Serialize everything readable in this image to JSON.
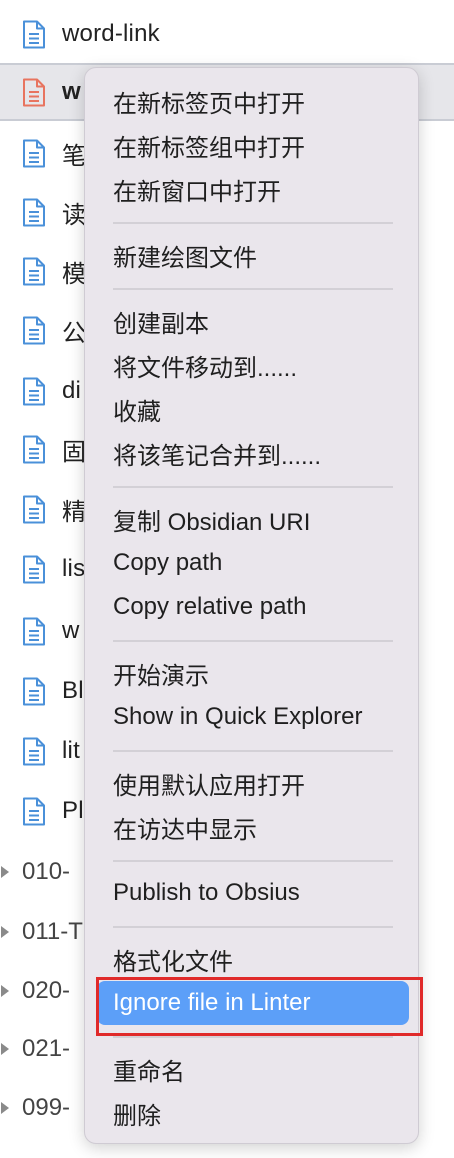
{
  "tree": {
    "files": [
      {
        "label": "word-link",
        "color": "#4a90d9",
        "selected": false
      },
      {
        "label": "w",
        "color": "#e8745f",
        "selected": true
      },
      {
        "label": "笔",
        "color": "#4a90d9",
        "selected": false
      },
      {
        "label": "读",
        "color": "#4a90d9",
        "selected": false
      },
      {
        "label": "模",
        "color": "#4a90d9",
        "selected": false
      },
      {
        "label": "公",
        "color": "#4a90d9",
        "selected": false
      },
      {
        "label": "di",
        "color": "#4a90d9",
        "selected": false
      },
      {
        "label": "固",
        "color": "#4a90d9",
        "selected": false
      },
      {
        "label": "精",
        "color": "#4a90d9",
        "selected": false
      },
      {
        "label": "lis",
        "color": "#4a90d9",
        "selected": false
      },
      {
        "label": "w",
        "color": "#4a90d9",
        "selected": false
      },
      {
        "label": "Bl",
        "color": "#4a90d9",
        "selected": false
      },
      {
        "label": "lit",
        "color": "#4a90d9",
        "selected": false
      },
      {
        "label": "Pl",
        "color": "#4a90d9",
        "selected": false
      }
    ],
    "folders": [
      {
        "label": "010-"
      },
      {
        "label": "011-T"
      },
      {
        "label": "020-"
      },
      {
        "label": "021-"
      },
      {
        "label": "099-"
      }
    ]
  },
  "menu": {
    "groups": [
      [
        "在新标签页中打开",
        "在新标签组中打开",
        "在新窗口中打开"
      ],
      [
        "新建绘图文件"
      ],
      [
        "创建副本",
        "将文件移动到......",
        "收藏",
        "将该笔记合并到......"
      ],
      [
        "复制 Obsidian URI",
        "Copy path",
        "Copy relative path"
      ],
      [
        "开始演示",
        "Show in Quick Explorer"
      ],
      [
        "使用默认应用打开",
        "在访达中显示"
      ],
      [
        "Publish to Obsius"
      ],
      [
        "格式化文件",
        "Ignore file in Linter"
      ],
      [
        "重命名",
        "删除"
      ]
    ],
    "active_item": "Ignore file in Linter",
    "active_color": "#5c9ff8"
  },
  "annotation": {
    "color": "#e02a2a"
  }
}
